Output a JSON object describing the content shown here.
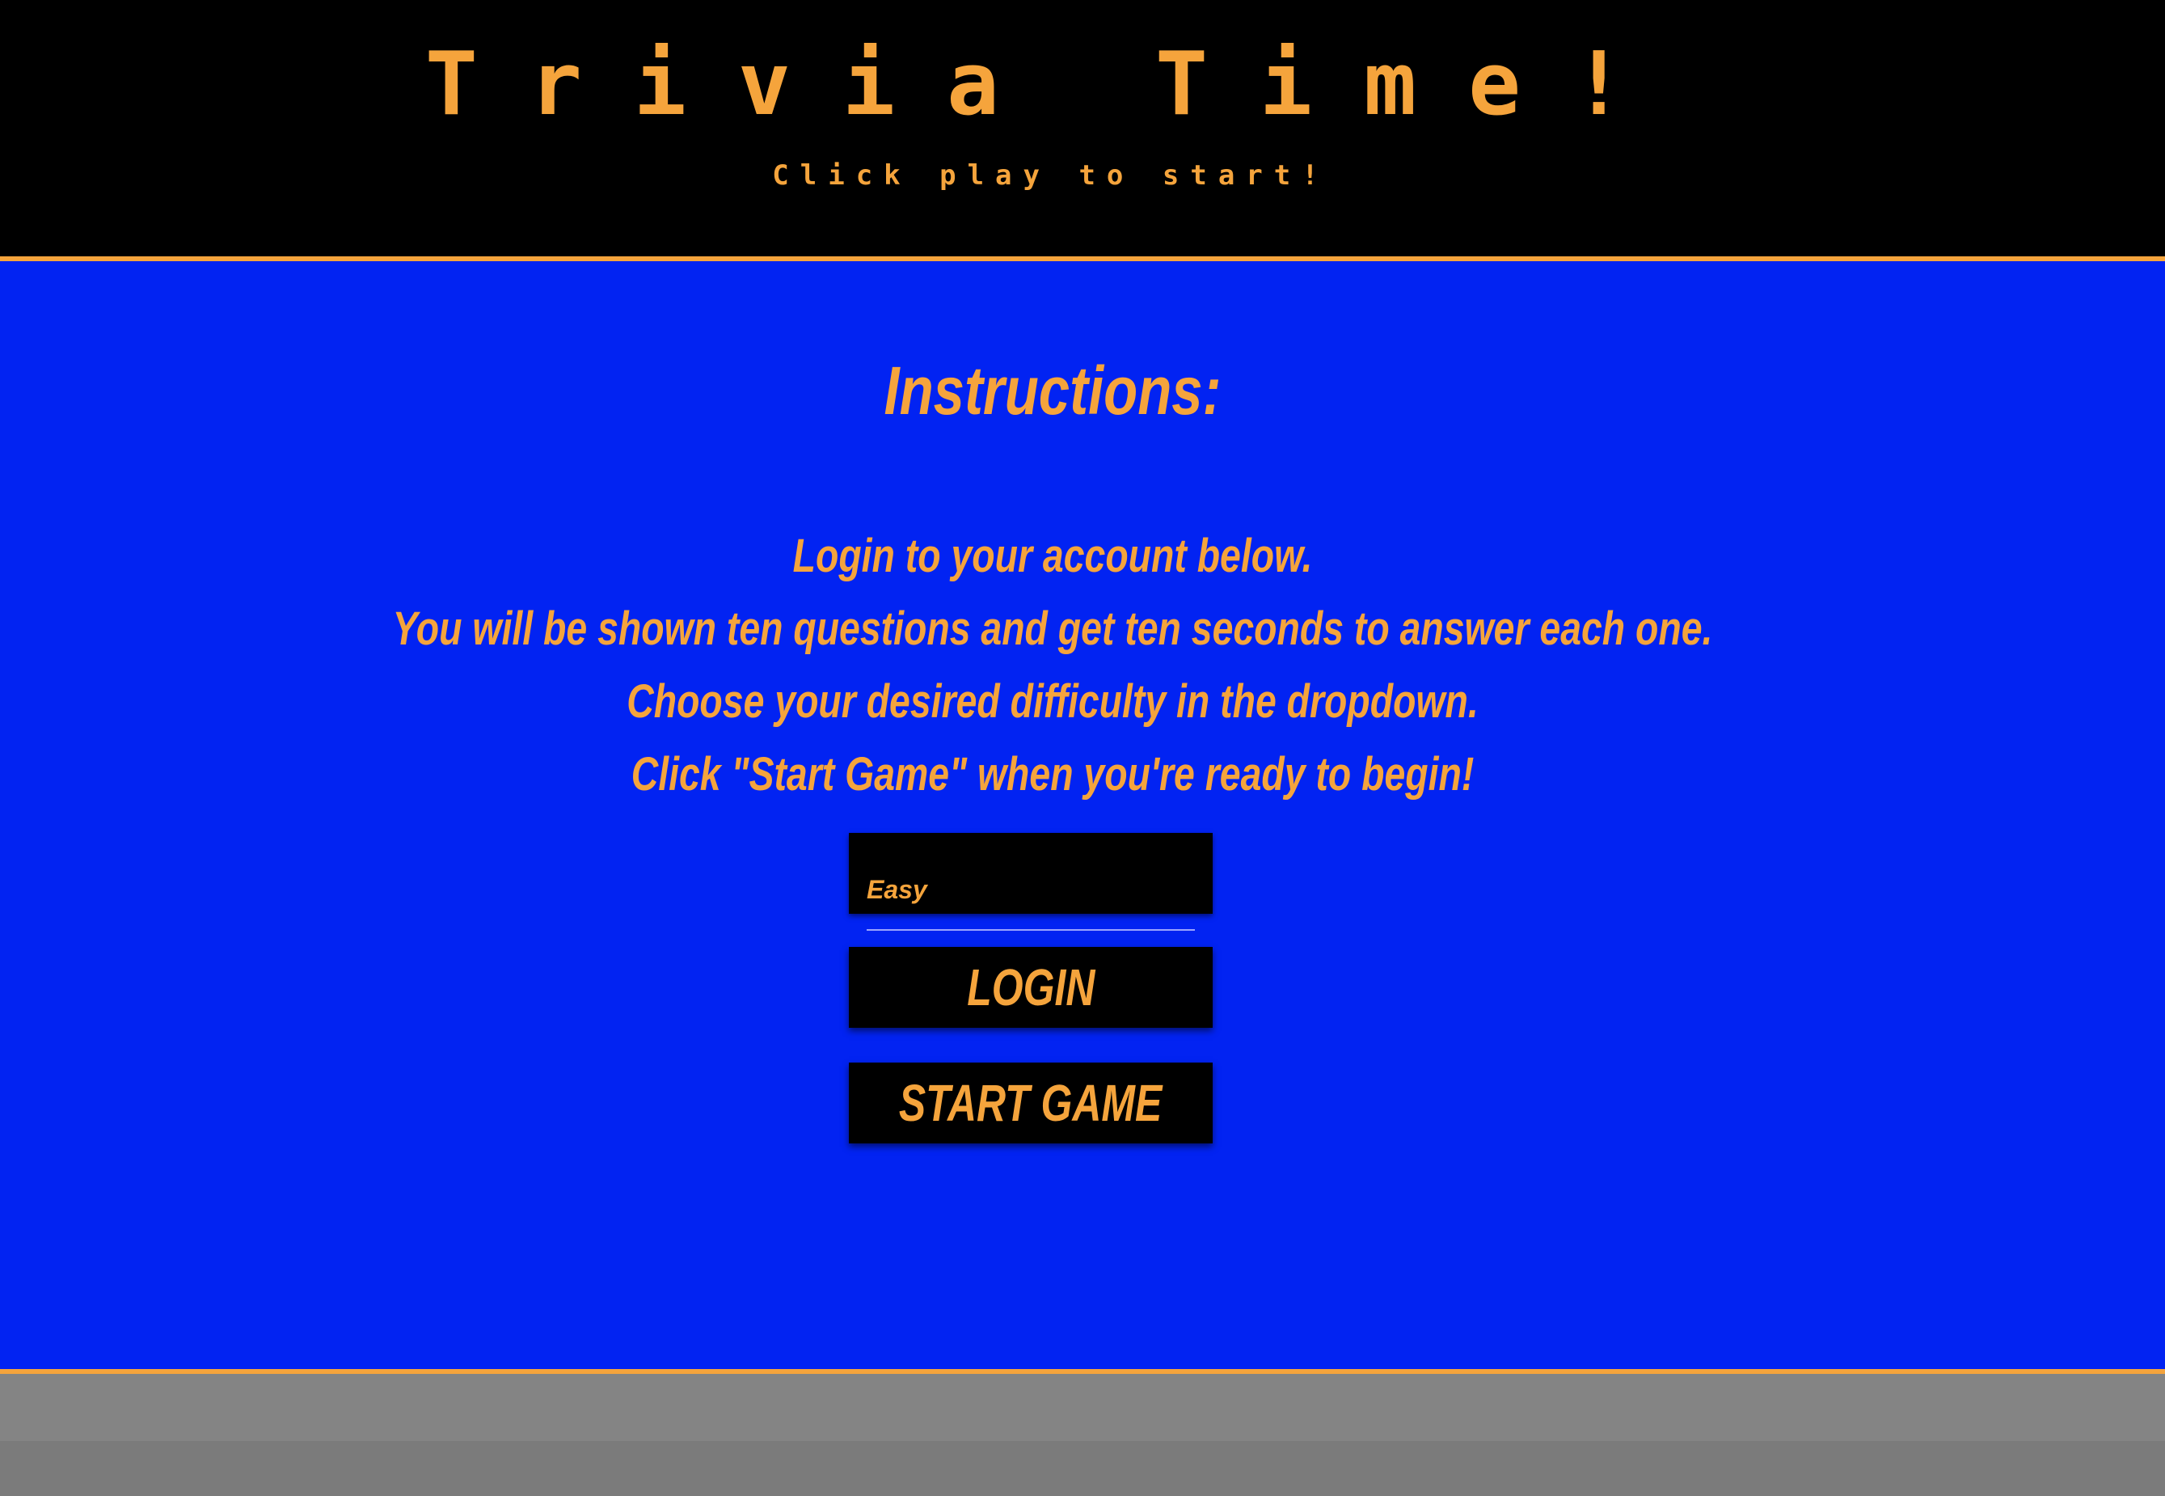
{
  "header": {
    "title": "Trivia Time!",
    "subtitle": "Click play to start!"
  },
  "instructions": {
    "heading": "Instructions:",
    "lines": [
      "Login to your account below.",
      "You will be shown ten questions and get ten seconds to answer each one.",
      "Choose your desired difficulty in the dropdown.",
      "Click \"Start Game\" when you're ready to begin!"
    ]
  },
  "difficulty_select": {
    "selected": "Easy"
  },
  "buttons": {
    "login": "LOGIN",
    "start_game": "START GAME"
  },
  "colors": {
    "accent": "#f5a43c",
    "background": "#0223f2",
    "header_bg": "#000000",
    "footer_bg": "#848484"
  }
}
